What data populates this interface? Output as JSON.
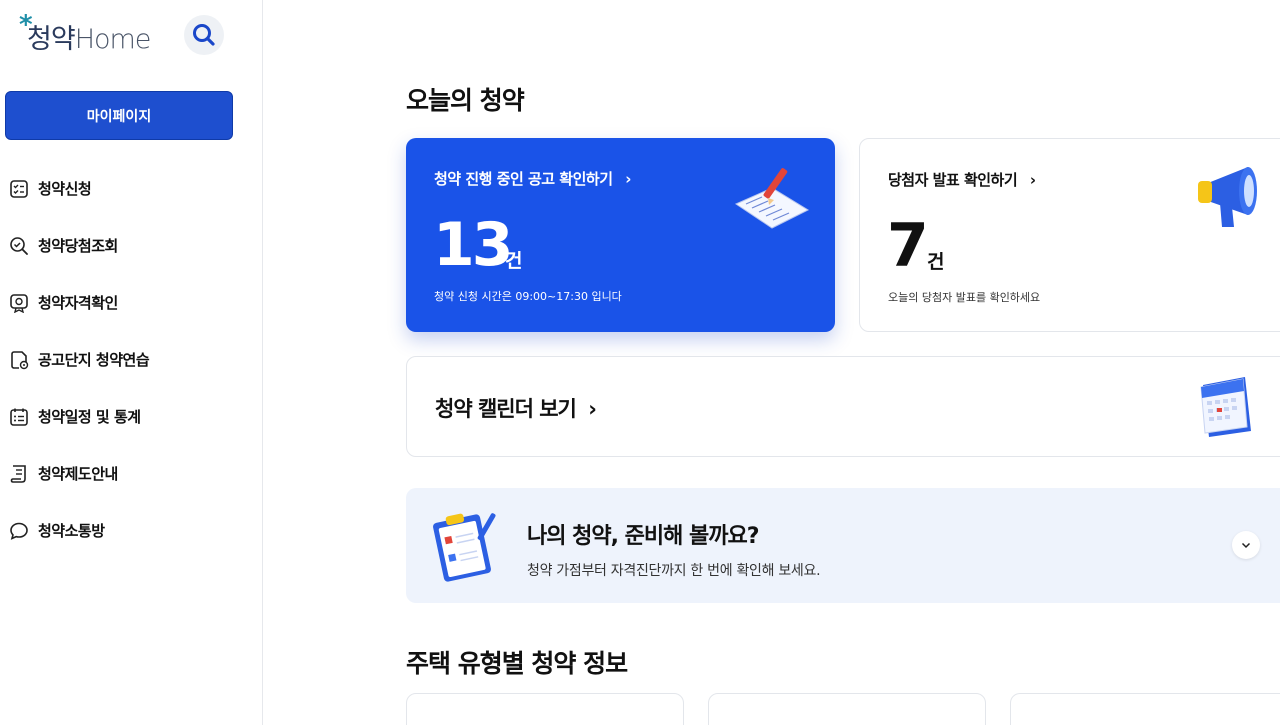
{
  "sidebar": {
    "logo_star": "*",
    "logo_ko": "청약",
    "logo_en": "Home",
    "mypage_label": "마이페이지",
    "items": [
      {
        "label": "청약신청",
        "icon": "checklist-icon"
      },
      {
        "label": "청약당첨조회",
        "icon": "search-check-icon"
      },
      {
        "label": "청약자격확인",
        "icon": "badge-icon"
      },
      {
        "label": "공고단지 청약연습",
        "icon": "practice-icon"
      },
      {
        "label": "청약일정 및 통계",
        "icon": "schedule-list-icon"
      },
      {
        "label": "청약제도안내",
        "icon": "guide-scroll-icon"
      },
      {
        "label": "청약소통방",
        "icon": "chat-bubble-icon"
      }
    ]
  },
  "main": {
    "today_title": "오늘의 청약",
    "ongoing": {
      "link": "청약 진행 중인 공고 확인하기",
      "count": "13",
      "unit": "건",
      "note": "청약 신청 시간은 09:00~17:30 입니다"
    },
    "winners": {
      "link": "당첨자 발표 확인하기",
      "count": "7",
      "unit": "건",
      "note": "오늘의 당첨자 발표를 확인하세요"
    },
    "calendar": {
      "link": "청약 캘린더 보기"
    },
    "prep": {
      "title": "나의 청약, 준비해 볼까요?",
      "subtitle": "청약 가점부터 자격진단까지 한 번에 확인해 보세요."
    },
    "types_title": "주택 유형별 청약 정보"
  },
  "colors": {
    "primary": "#1a53e8",
    "mypage": "#1e4fcf",
    "prep_bg": "#eef3fc"
  }
}
